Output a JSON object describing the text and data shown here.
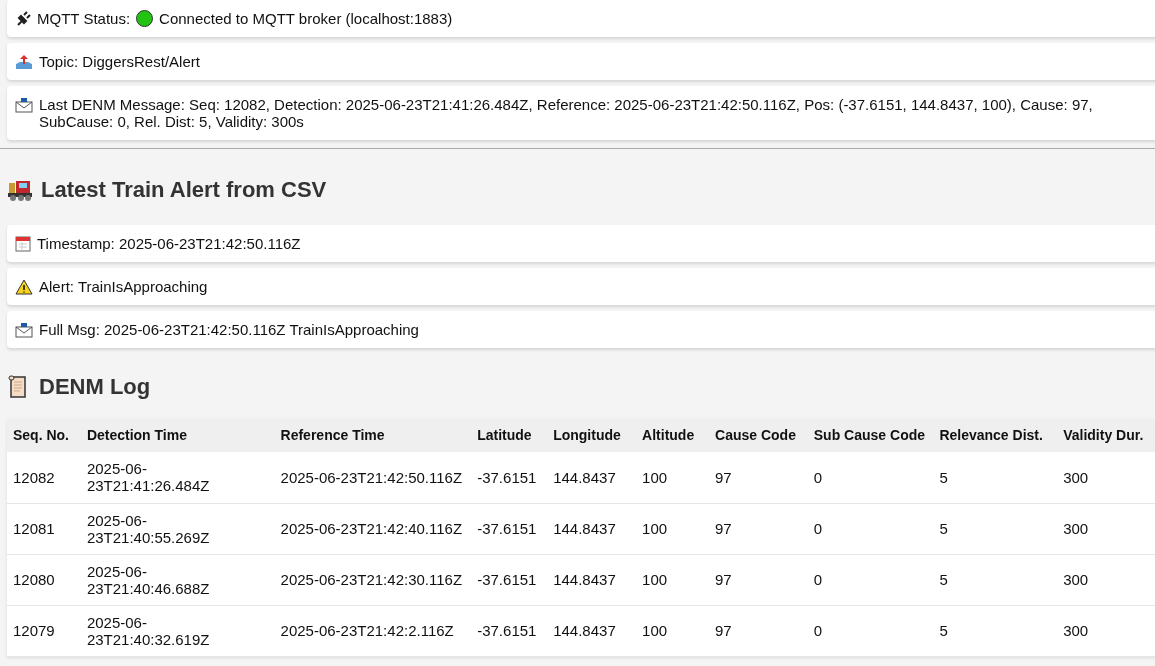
{
  "status_cards": [
    {
      "kind": "mqtt",
      "label": "MQTT Status:",
      "connected": true,
      "text": "Connected to MQTT broker (localhost:1883)"
    },
    {
      "kind": "topic",
      "text": "Topic: DiggersRest/Alert"
    },
    {
      "kind": "message",
      "text": "Last DENM Message: Seq: 12082, Detection: 2025-06-23T21:41:26.484Z, Reference: 2025-06-23T21:42:50.116Z, Pos: (-37.6151, 144.8437, 100), Cause: 97, SubCause: 0, Rel. Dist: 5, Validity: 300s"
    }
  ],
  "train_alert": {
    "title": "Latest Train Alert from CSV",
    "cards": [
      {
        "kind": "calendar",
        "text": "Timestamp: 2025-06-23T21:42:50.116Z"
      },
      {
        "kind": "warning",
        "text": "Alert: TrainIsApproaching"
      },
      {
        "kind": "message",
        "text": "Full Msg: 2025-06-23T21:42:50.116Z TrainIsApproaching"
      }
    ]
  },
  "denm_log": {
    "title": "DENM Log",
    "columns": [
      "Seq. No.",
      "Detection Time",
      "Reference Time",
      "Latitude",
      "Longitude",
      "Altitude",
      "Cause Code",
      "Sub Cause Code",
      "Relevance Dist.",
      "Validity Dur."
    ],
    "rows": [
      [
        "12082",
        "2025-06-23T21:41:26.484Z",
        "2025-06-23T21:42:50.116Z",
        "-37.6151",
        "144.8437",
        "100",
        "97",
        "0",
        "5",
        "300"
      ],
      [
        "12081",
        "2025-06-23T21:40:55.269Z",
        "2025-06-23T21:42:40.116Z",
        "-37.6151",
        "144.8437",
        "100",
        "97",
        "0",
        "5",
        "300"
      ],
      [
        "12080",
        "2025-06-23T21:40:46.688Z",
        "2025-06-23T21:42:30.116Z",
        "-37.6151",
        "144.8437",
        "100",
        "97",
        "0",
        "5",
        "300"
      ],
      [
        "12079",
        "2025-06-23T21:40:32.619Z",
        "2025-06-23T21:42:2.116Z",
        "-37.6151",
        "144.8437",
        "100",
        "97",
        "0",
        "5",
        "300"
      ]
    ]
  }
}
